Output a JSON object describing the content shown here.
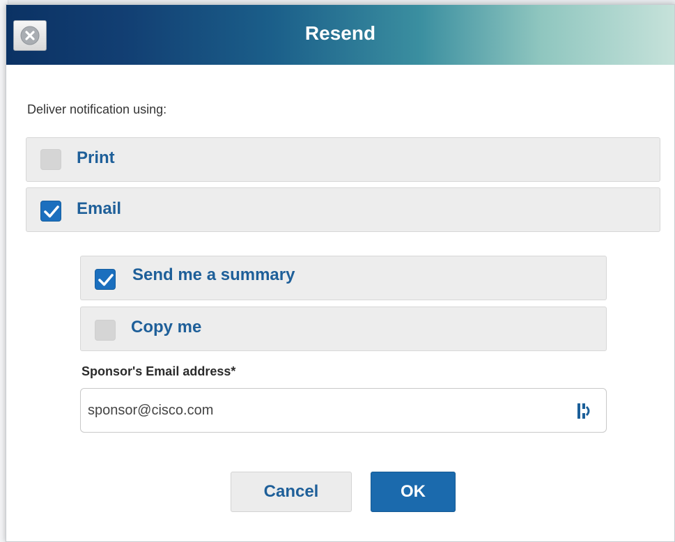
{
  "dialog": {
    "title": "Resend",
    "close_icon": "close-icon"
  },
  "deliver": {
    "label": "Deliver notification using:",
    "options": [
      {
        "label": "Print",
        "checked": false
      },
      {
        "label": "Email",
        "checked": true
      }
    ]
  },
  "email_options": [
    {
      "label": "Send me a summary",
      "checked": true
    },
    {
      "label": "Copy me",
      "checked": false
    }
  ],
  "sponsor_email": {
    "label": "Sponsor's Email address*",
    "value": "sponsor@cisco.com",
    "icon": "contact-card-icon"
  },
  "buttons": {
    "cancel": "Cancel",
    "ok": "OK"
  },
  "colors": {
    "accent": "#1b6aad",
    "label_blue": "#1e5f99",
    "titlebar_dark": "#0b3264",
    "titlebar_light": "#c6e2da"
  }
}
